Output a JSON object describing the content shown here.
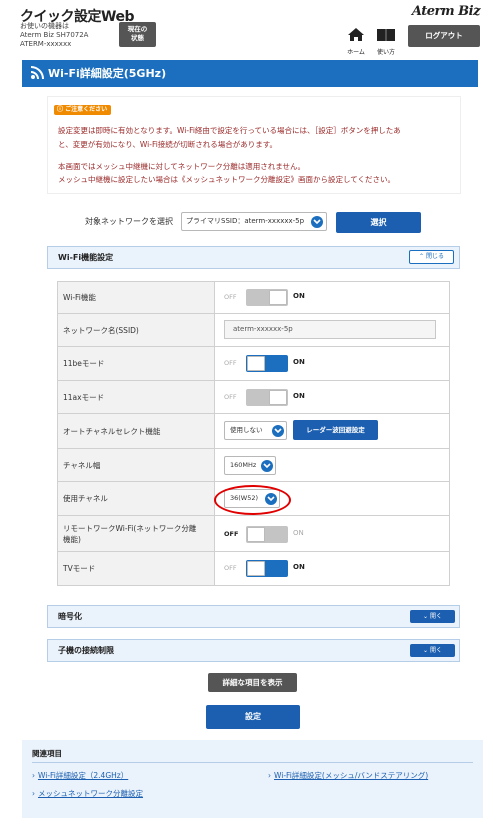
{
  "header": {
    "app_title": "クイック設定Web",
    "device_label": "お使いの機器は",
    "device_model": "Aterm Biz SH7072A",
    "device_id": "ATERM-xxxxxx",
    "current_status_line1": "現在の",
    "current_status_line2": "状態",
    "brand": "Aterm Biz",
    "home_label": "ホーム",
    "help_label": "使い方",
    "logout_label": "ログアウト"
  },
  "page": {
    "title": "Wi-Fi詳細設定(5GHz)"
  },
  "notice": {
    "badge": "ご注意ください",
    "line1": "設定変更は即時に有効となります。Wi-Fi経由で設定を行っている場合には、［設定］ボタンを押したあ",
    "line2": "と、変更が有効になり、Wi-Fi接続が切断される場合があります。",
    "line3": "本画面ではメッシュ中継機に対してネットワーク分離は適用されません。",
    "line4": "メッシュ中継機に設定したい場合は《メッシュネットワーク分離設定》画面から設定してください。"
  },
  "network_select": {
    "label": "対象ネットワークを選択",
    "value": "プライマリSSID：aterm-xxxxxx-5p",
    "button": "選択"
  },
  "wifi_panel": {
    "title": "Wi-Fi機能設定",
    "close_label": "閉じる",
    "rows": [
      {
        "label": "Wi-Fi機能",
        "off": "OFF",
        "on": "ON",
        "state": "off"
      },
      {
        "label": "ネットワーク名(SSID)",
        "value": "aterm-xxxxxx-5p"
      },
      {
        "label": "11beモード",
        "off": "OFF",
        "on": "ON",
        "state": "on"
      },
      {
        "label": "11axモード",
        "off": "OFF",
        "on": "ON",
        "state": "off"
      },
      {
        "label": "オートチャネルセレクト機能",
        "select": "使用しない",
        "button": "レーダー波回避設定"
      },
      {
        "label": "チャネル幅",
        "select": "160MHz"
      },
      {
        "label": "使用チャネル",
        "select": "36(W52)"
      },
      {
        "label_line1": "リモートワークWi-Fi(ネットワーク分離",
        "label_line2": "機能)",
        "off": "OFF",
        "on": "ON",
        "state": "off"
      },
      {
        "label": "TVモード",
        "off": "OFF",
        "on": "ON",
        "state": "on"
      }
    ]
  },
  "encryption_panel": {
    "title": "暗号化",
    "open_label": "開く"
  },
  "child_panel": {
    "title": "子機の接続制限",
    "open_label": "開く"
  },
  "buttons": {
    "show_details": "詳細な項目を表示",
    "apply": "設定"
  },
  "related": {
    "title": "関連項目",
    "links": [
      "Wi-Fi詳細設定（2.4GHz）",
      "Wi-Fi詳細設定(メッシュ/バンドステアリング)",
      "メッシュネットワーク分離設定"
    ]
  },
  "colors": {
    "primary": "#1c6fbe",
    "button_dark": "#555555",
    "highlight": "#e00000",
    "notice_text": "#9b2a2a",
    "badge": "#f08a00"
  }
}
